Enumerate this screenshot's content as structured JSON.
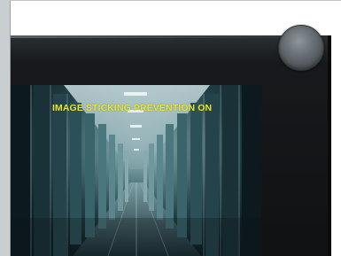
{
  "screen": {
    "osd_message": "IMAGE STICKING PREVENTION ON"
  },
  "colors": {
    "osd_text": "#e8e23a",
    "bezel": "#17191c",
    "background": "#ffffff"
  },
  "icons": {
    "knob": "monitor-control-knob"
  }
}
